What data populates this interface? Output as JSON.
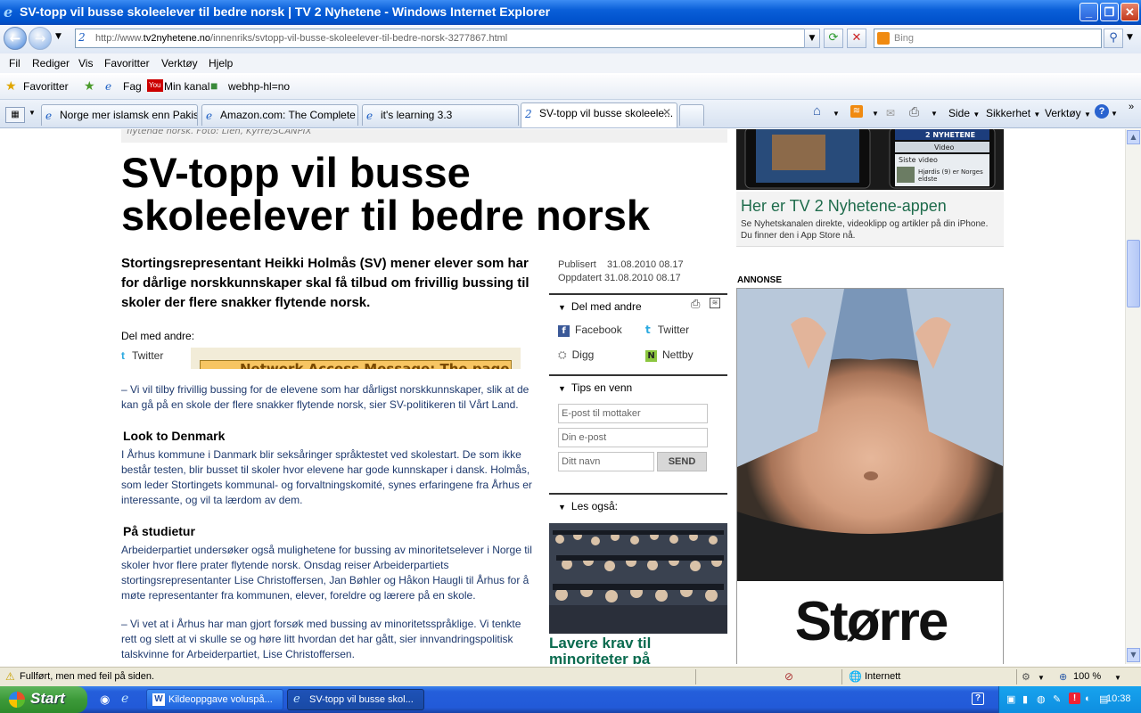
{
  "window": {
    "title": "SV-topp vil busse skoleelever til bedre norsk |   TV 2 Nyhetene - Windows Internet Explorer"
  },
  "address": {
    "url_prefix": "http://www.",
    "url_domain": "tv2nyhetene.no",
    "url_path": "/innenriks/svtopp-vil-busse-skoleelever-til-bedre-norsk-3277867.html",
    "search_placeholder": "Bing"
  },
  "menu": [
    "Fil",
    "Rediger",
    "Vis",
    "Favoritter",
    "Verktøy",
    "Hjelp"
  ],
  "favorites": {
    "label": "Favoritter",
    "items": [
      "Fag",
      "Min kanal",
      "webhp-hl=no"
    ]
  },
  "tabs": [
    {
      "label": "Norge mer islamsk enn Pakist..."
    },
    {
      "label": "Amazon.com: The Complete ..."
    },
    {
      "label": "it's learning 3.3"
    },
    {
      "label": "SV-topp vil busse skoleele..."
    }
  ],
  "commandbar": {
    "side": "Side",
    "sikkerhet": "Sikkerhet",
    "verktoy": "Verktøy"
  },
  "article": {
    "caption": "flytende norsk. Foto: Lien, Kyrre/SCANPIX",
    "headline": "SV-topp vil busse skoleelever til bedre norsk",
    "lead": "Stortingsrepresentant Heikki Holmås (SV) mener elever som har for dårlige norskkunnskaper skal få tilbud om frivillig bussing til skoler der flere snakker flytende norsk.",
    "share_label": "Del med andre:",
    "twitter": "Twitter",
    "error_text": "Network Access Message: The page",
    "p1": "– Vi vil tilby frivillig bussing for de elevene som har dårligst norskkunnskaper, slik at de kan gå på en skole der flere snakker flytende norsk, sier SV-politikeren til Vårt Land.",
    "h2a": "Look to Denmark",
    "p2": "I Århus kommune i Danmark blir seksåringer språktestet ved skolestart. De som ikke består testen, blir busset til skoler hvor elevene har gode kunnskaper i dansk. Holmås, som leder Stortingets kommunal- og forvaltningskomité, synes erfaringene fra Århus er interessante, og vil ta lærdom av dem.",
    "h2b": "På studietur",
    "p3": "Arbeiderpartiet undersøker også mulighetene for bussing av minoritetselever i Norge til skoler hvor flere prater flytende norsk. Onsdag reiser Arbeiderpartiets stortingsrepresentanter Lise Christoffersen, Jan Bøhler og Håkon Haugli til Århus for å møte representanter fra kommunen, elever, foreldre og lærere på en skole.",
    "p4": "– Vi vet at i Århus har man gjort forsøk med bussing av minoritetsspråklige. Vi tenkte rett og slett at vi skulle se og høre litt hvordan det har gått, sier innvandringspolitisk talskvinne for Arbeiderpartiet, Lise Christoffersen."
  },
  "meta": {
    "publisert_label": "Publisert",
    "publisert": "31.08.2010 08.17",
    "oppdatert_label": "Oppdatert",
    "oppdatert": "31.08.2010 08.17"
  },
  "share": {
    "heading": "Del med andre",
    "facebook": "Facebook",
    "twitter": "Twitter",
    "digg": "Digg",
    "nettby": "Nettby"
  },
  "tips": {
    "heading": "Tips en venn",
    "to_placeholder": "E-post til mottaker",
    "from_placeholder": "Din e-post",
    "name_placeholder": "Ditt navn",
    "send": "SEND"
  },
  "les": {
    "heading": "Les også:",
    "title": "Lavere krav til minoriteter på"
  },
  "app": {
    "title": "Her er TV 2 Nyhetene-appen",
    "desc": "Se Nyhetskanalen direkte, videoklipp og artikler på din iPhone. Du finner den i App Store nå.",
    "screen_label1": "2 NYHETENE",
    "screen_label2": "Video",
    "screen_label3": "Siste video",
    "screen_label4": "Hjørdis (9) er Norges eldste"
  },
  "ad": {
    "label": "ANNONSE",
    "text": "Større"
  },
  "status": {
    "text": "Fullført, men med feil på siden.",
    "zone": "Internett",
    "zoom": "100 %"
  },
  "taskbar": {
    "start": "Start",
    "items": [
      "Kildeoppgave voluspå...",
      "SV-topp vil busse skol..."
    ],
    "time": "10:38"
  }
}
